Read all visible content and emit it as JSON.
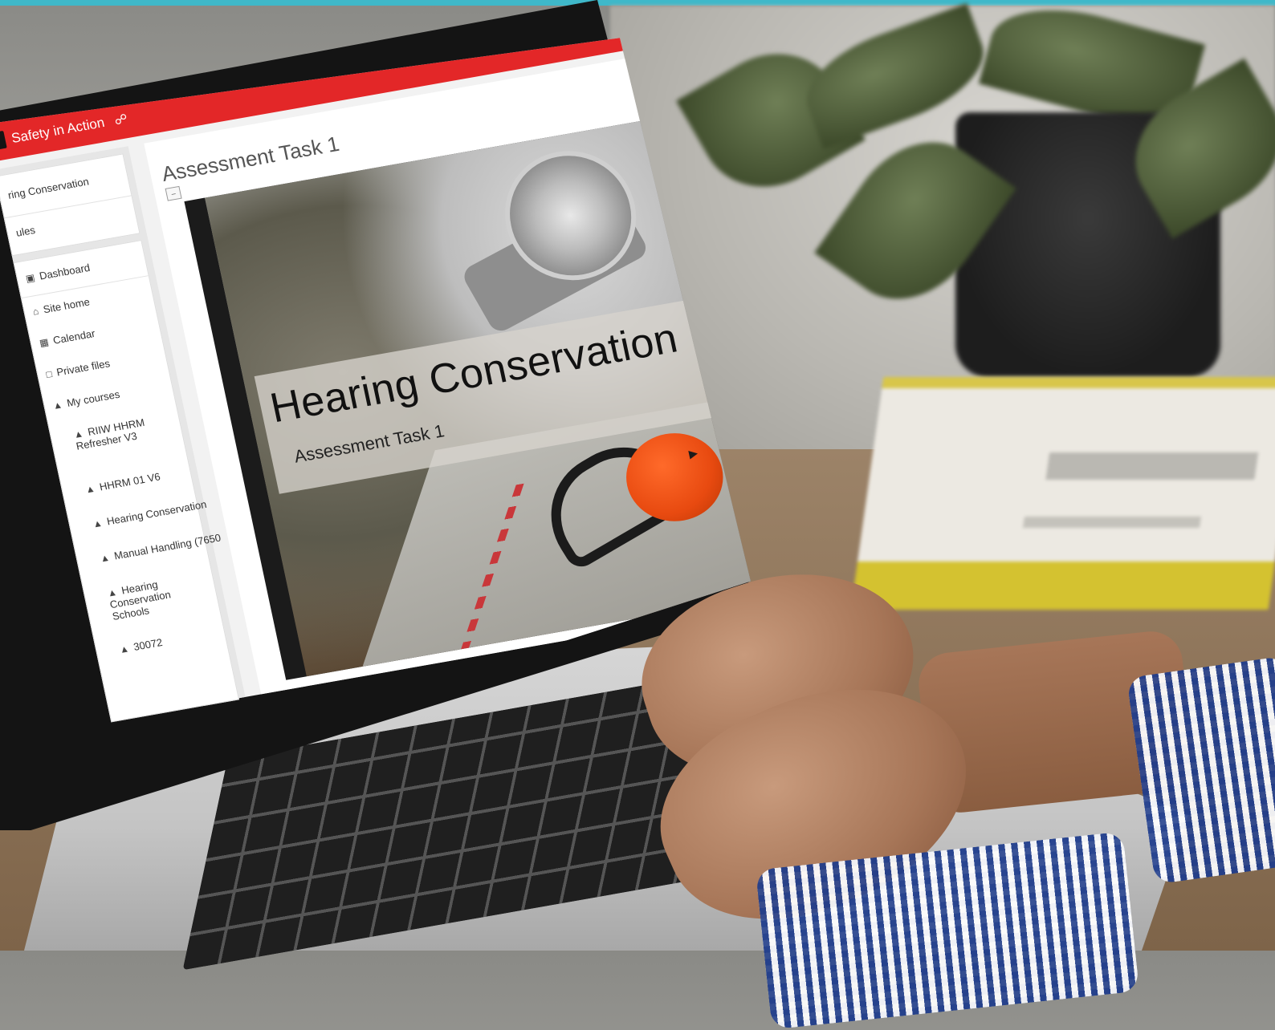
{
  "app": {
    "brand": "Safety in Action",
    "share_icon": "share-icon",
    "page_heading": "Assessment Task 1"
  },
  "sidebar": {
    "top_card": [
      {
        "label": "ring Conservation"
      },
      {
        "label": "ules"
      }
    ],
    "nav": [
      {
        "icon": "dashboard-icon",
        "label": "Dashboard"
      },
      {
        "icon": "home-icon",
        "label": "Site home"
      },
      {
        "icon": "calendar-icon",
        "label": "Calendar"
      },
      {
        "icon": "file-icon",
        "label": "Private files"
      },
      {
        "icon": "graduation-cap-icon",
        "label": "My courses"
      }
    ],
    "courses": [
      {
        "label": "RIIW HHRM Refresher V3"
      },
      {
        "label": "HHRM 01 V6"
      },
      {
        "label": "Hearing Conservation"
      },
      {
        "label": "Manual Handling (7650"
      },
      {
        "label": "Hearing Conservation Schools"
      },
      {
        "label": "30072"
      }
    ]
  },
  "slide": {
    "title": "Hearing Conservation",
    "subtitle": "Assessment Task 1"
  },
  "colors": {
    "accent_red": "#e32728",
    "top_strip": "#3fb8c9",
    "earmuff_orange": "#e84a10"
  }
}
